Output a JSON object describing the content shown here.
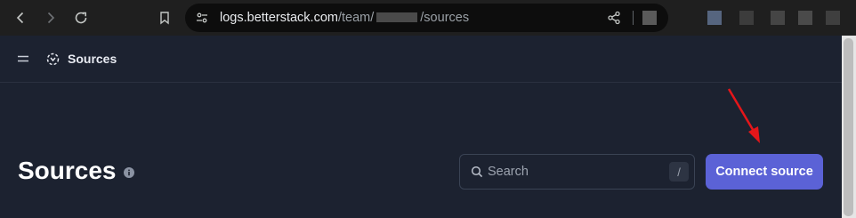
{
  "browser": {
    "icons": [
      "back-icon",
      "forward-icon",
      "reload-icon",
      "bookmark-icon",
      "site-info-icon",
      "share-icon"
    ],
    "url": {
      "host": "logs.betterstack.com",
      "path_prefix": "/team/",
      "path_suffix": "/sources"
    }
  },
  "app": {
    "header": {
      "title": "Sources",
      "icons": [
        "menu-icon",
        "sources-icon"
      ]
    },
    "page_title": "Sources",
    "search": {
      "placeholder": "Search",
      "shortcut": "/"
    },
    "connect_button": {
      "label": "Connect source"
    }
  },
  "annotation": {
    "type": "arrow",
    "color": "#e5161a"
  },
  "colors": {
    "accent": "#5b62d6",
    "background": "#1c2230",
    "browser_bar": "#1f1f1f"
  }
}
